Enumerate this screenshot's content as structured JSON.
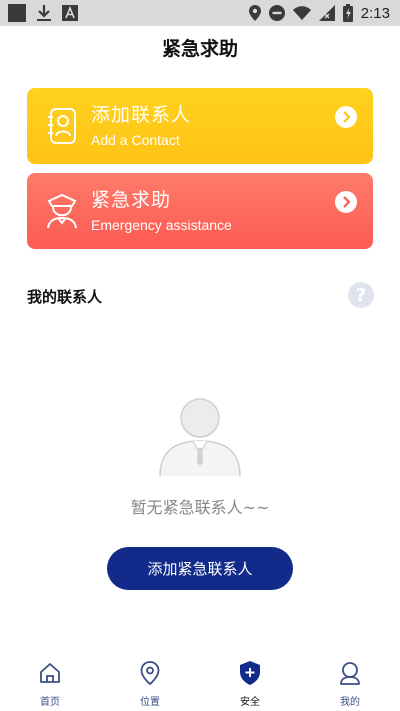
{
  "status_bar": {
    "time": "2:13"
  },
  "page_title": "紧急求助",
  "cards": [
    {
      "title": "添加联系人",
      "subtitle": "Add a Contact",
      "icon": "contact-card-icon",
      "color": "#ffc316"
    },
    {
      "title": "紧急求助",
      "subtitle": "Emergency assistance",
      "icon": "police-officer-icon",
      "color": "#fb5a52"
    }
  ],
  "contacts_section": {
    "title": "我的联系人",
    "help_icon": "question-mark-icon"
  },
  "empty_state": {
    "text": "暂无紧急联系人~~",
    "icon": "person-placeholder-icon"
  },
  "add_button": {
    "label": "添加紧急联系人",
    "color": "#122a8a"
  },
  "tabs": [
    {
      "label": "首页",
      "icon": "home-icon",
      "active": false
    },
    {
      "label": "位置",
      "icon": "location-pin-icon",
      "active": false
    },
    {
      "label": "安全",
      "icon": "shield-plus-icon",
      "active": true
    },
    {
      "label": "我的",
      "icon": "user-profile-icon",
      "active": false
    }
  ]
}
